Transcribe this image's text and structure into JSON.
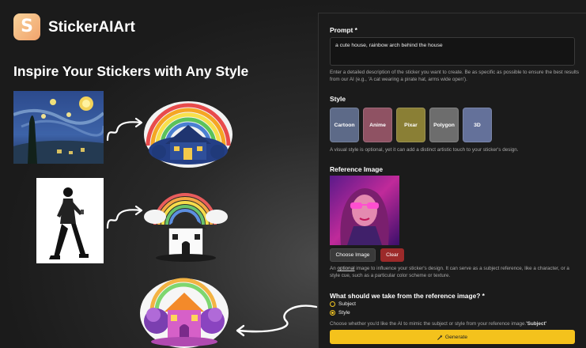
{
  "brand": {
    "name": "StickerAIArt",
    "logo_letter": "S"
  },
  "headline": "Inspire Your Stickers with Any Style",
  "form": {
    "prompt": {
      "label": "Prompt *",
      "value": "a cute house, rainbow arch behind the house",
      "help": "Enter a detailed description of the sticker you want to create. Be as specific as possible to ensure the best results from our AI (e.g., 'A cat wearing a pirate hat, arms wide open')."
    },
    "style": {
      "label": "Style",
      "options": [
        {
          "label": "Cartoon",
          "color": "#5d6a88"
        },
        {
          "label": "Anime",
          "color": "#8f5263"
        },
        {
          "label": "Pixar",
          "color": "#8a7f35"
        },
        {
          "label": "Polygon",
          "color": "#6d6d6d"
        },
        {
          "label": "3D",
          "color": "#64719a"
        }
      ],
      "help": "A visual style is optional, yet it can add a distinct artistic touch to your sticker's design."
    },
    "reference": {
      "label": "Reference Image",
      "choose_label": "Choose Image",
      "clear_label": "Clear",
      "help_prefix": "An ",
      "help_optional": "optional",
      "help_rest": " image to influence your sticker's design. It can serve as a subject reference, like a character, or a style cue, such as a particular color scheme or texture."
    },
    "take": {
      "label": "What should we take from the reference image? *",
      "options": [
        {
          "label": "Subject",
          "selected": false
        },
        {
          "label": "Style",
          "selected": true
        }
      ],
      "help": "Choose whether you'd like the AI to mimic the subject or style from your reference image.",
      "help_strong": "'Subject'"
    },
    "generate_label": "Generate",
    "generate_icon": "magic-wand-icon"
  },
  "colors": {
    "accent": "#f4c21c",
    "clear": "#9c2a2a",
    "panel": "#1b1b1b"
  }
}
